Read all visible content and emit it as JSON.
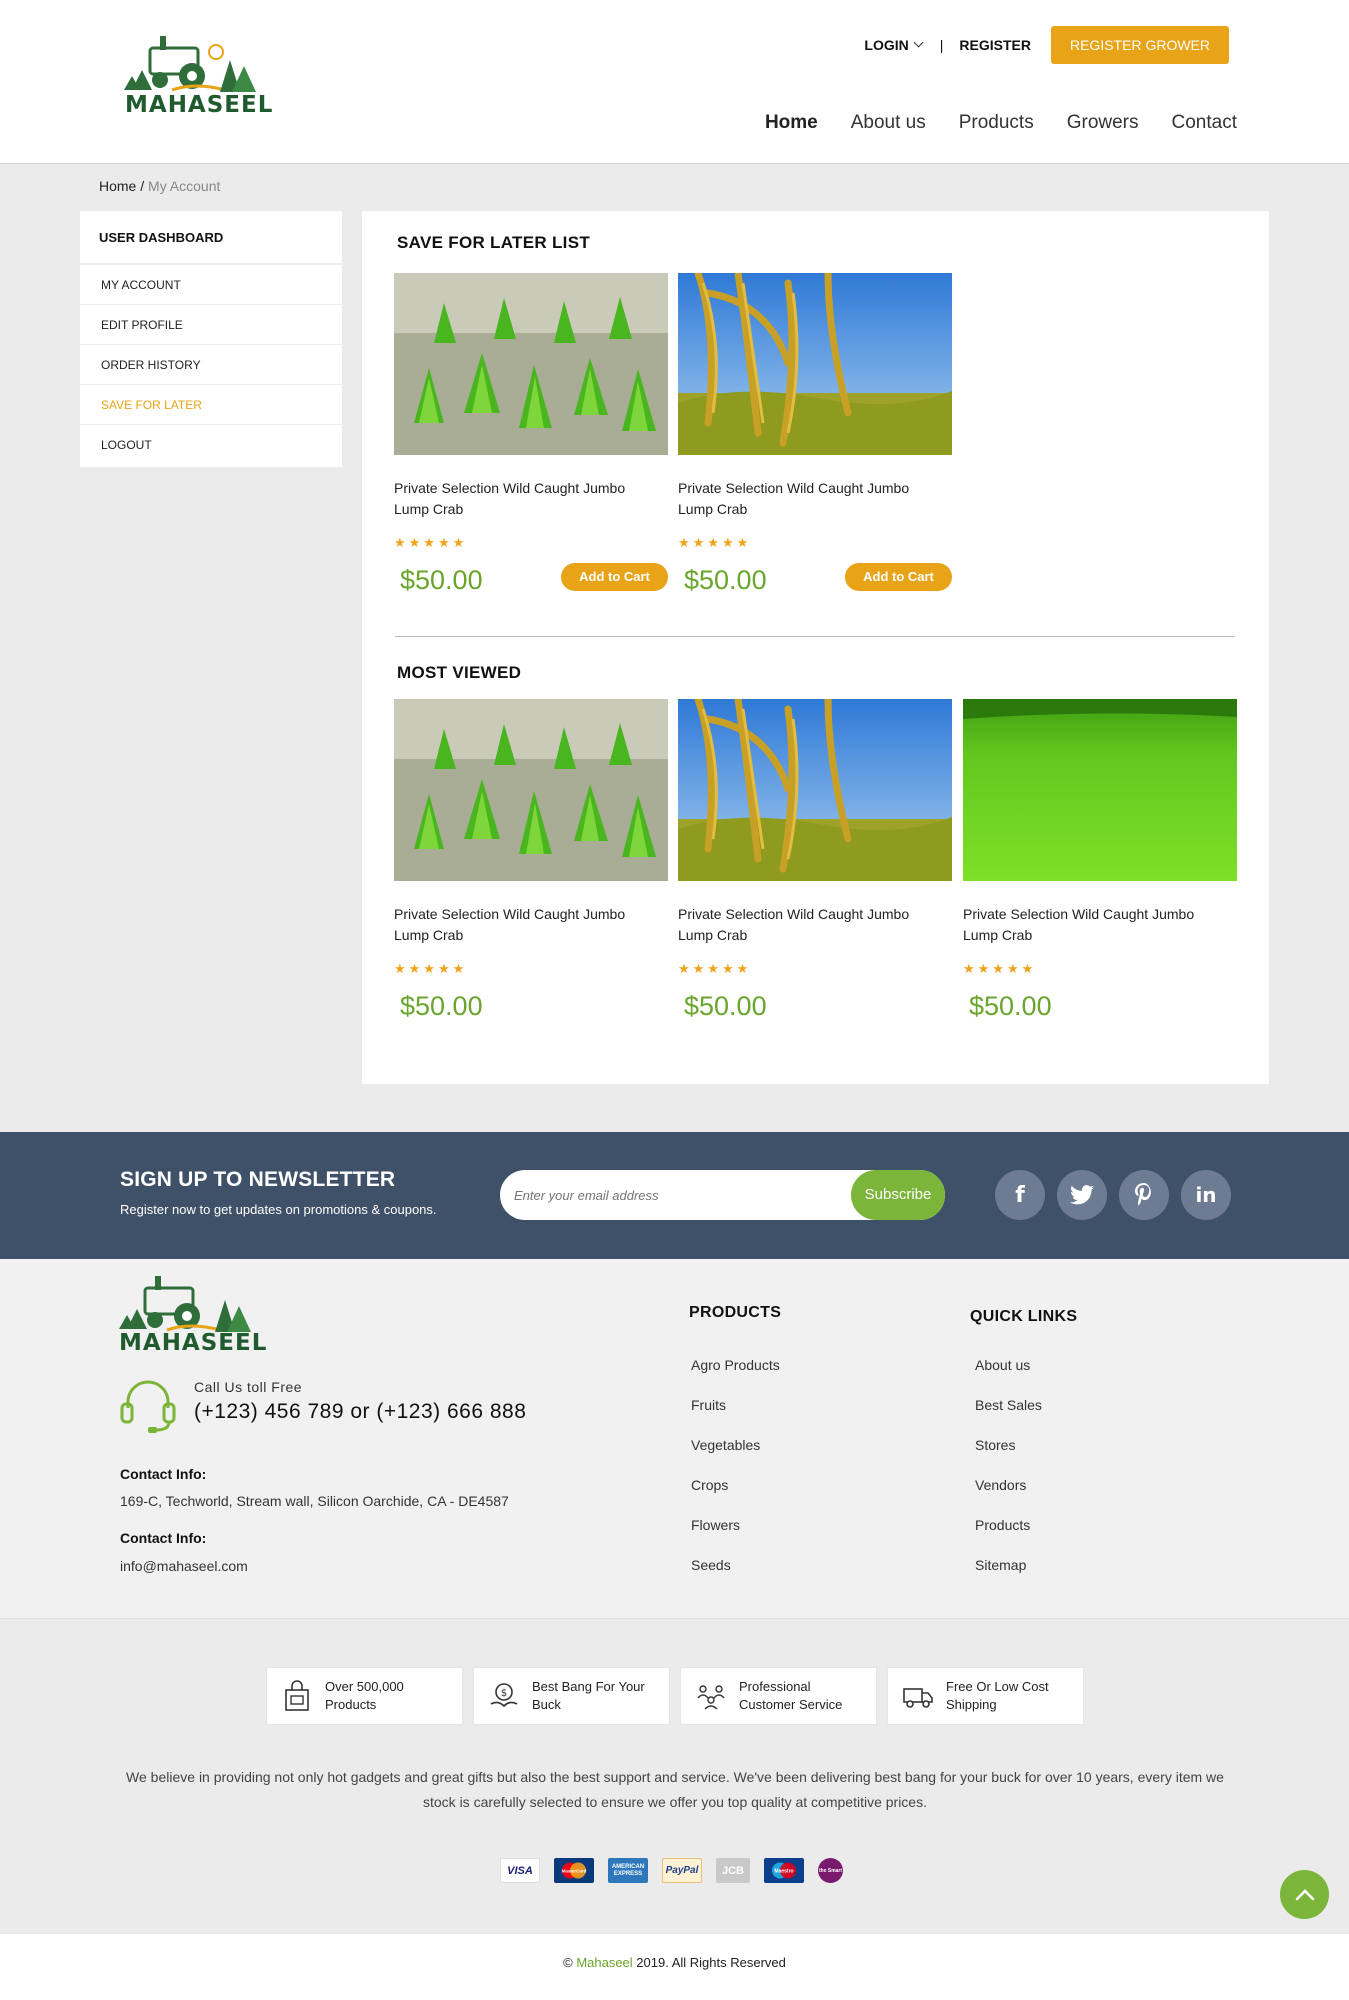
{
  "header": {
    "brand": "MAHASEEL",
    "login": "LOGIN",
    "separator": "|",
    "register": "REGISTER",
    "register_grower": "REGISTER GROWER",
    "nav": [
      "Home",
      "About us",
      "Products",
      "Growers",
      "Contact"
    ],
    "active_nav": "Home"
  },
  "breadcrumb": {
    "home": "Home",
    "separator": "/",
    "current": "My Account"
  },
  "sidebar": {
    "heading": "USER DASHBOARD",
    "items": [
      "MY ACCOUNT",
      "EDIT PROFILE",
      "ORDER HISTORY",
      "SAVE FOR LATER",
      "LOGOUT"
    ],
    "active": "SAVE FOR LATER"
  },
  "save_for_later": {
    "title": "SAVE FOR LATER LIST",
    "products": [
      {
        "image": "rice-seedlings",
        "name": "Private Selection Wild Caught Jumbo Lump Crab",
        "rating": "★★★★★",
        "price": "$50.00",
        "cta": "Add to Cart"
      },
      {
        "image": "rice-grain",
        "name": "Private Selection Wild Caught Jumbo Lump Crab",
        "rating": "★★★★★",
        "price": "$50.00",
        "cta": "Add to Cart"
      }
    ]
  },
  "most_viewed": {
    "title": "MOST VIEWED",
    "products": [
      {
        "image": "rice-seedlings",
        "name": "Private Selection Wild Caught Jumbo Lump Crab",
        "rating": "★★★★★",
        "price": "$50.00"
      },
      {
        "image": "rice-grain",
        "name": "Private Selection Wild Caught Jumbo Lump Crab",
        "rating": "★★★★★",
        "price": "$50.00"
      },
      {
        "image": "green-field",
        "name": "Private Selection Wild Caught Jumbo Lump Crab",
        "rating": "★★★★★",
        "price": "$50.00"
      }
    ]
  },
  "newsletter": {
    "title": "SIGN UP TO NEWSLETTER",
    "subtitle": "Register now to get updates on promotions & coupons.",
    "placeholder": "Enter your email address",
    "button": "Subscribe",
    "social": [
      "facebook-icon",
      "twitter-icon",
      "pinterest-icon",
      "linkedin-icon"
    ]
  },
  "footer": {
    "brand": "MAHASEEL",
    "call_label": "Call Us toll Free",
    "call_number": "(+123) 456 789 or (+123) 666 888",
    "contact_heading_1": "Contact Info:",
    "address": "169-C, Techworld, Stream wall, Silicon Oarchide, CA - DE4587",
    "contact_heading_2": "Contact Info:",
    "email": "info@mahaseel.com",
    "products_heading": "PRODUCTS",
    "products_links": [
      "Agro Products",
      "Fruits",
      "Vegetables",
      "Crops",
      "Flowers",
      "Seeds"
    ],
    "quick_heading": "QUICK LINKS",
    "quick_links": [
      "About us",
      "Best Sales",
      "Stores",
      "Vendors",
      "Products",
      "Sitemap"
    ]
  },
  "features": [
    {
      "icon": "shopping-bag-icon",
      "line1": "Over 500,000",
      "line2": "Products"
    },
    {
      "icon": "money-hand-icon",
      "line1": "Best Bang For Your",
      "line2": "Buck"
    },
    {
      "icon": "customer-service-icon",
      "line1": "Professional",
      "line2": "Customer Service"
    },
    {
      "icon": "delivery-truck-icon",
      "line1": "Free Or Low Cost",
      "line2": "Shipping"
    }
  ],
  "about_text": "We believe in providing not only hot gadgets and great gifts but also the best support and service. We've been delivering best bang for your buck for over 10 years, every item we stock is carefully selected to ensure we offer you top quality at competitive prices.",
  "payments": [
    "VISA",
    "MasterCard",
    "AMERICAN EXPRESS",
    "PayPal",
    "JCB",
    "Maestro",
    "the Smart"
  ],
  "copyright": {
    "prefix": "© ",
    "brand": "Mahaseel",
    "suffix": " 2019. All Rights Reserved"
  },
  "colors": {
    "accent": "#e8a317",
    "green": "#6aa52d",
    "newsletter_bg": "#3f5069"
  }
}
